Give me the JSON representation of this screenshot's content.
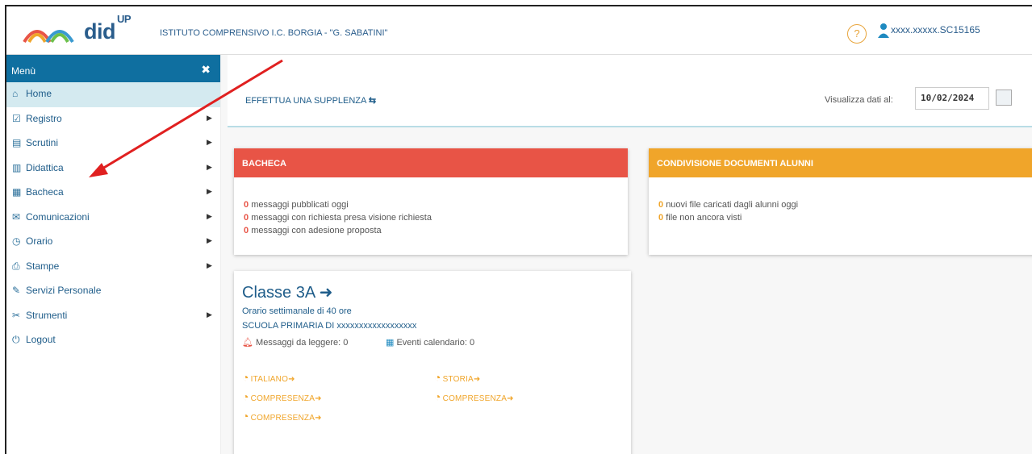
{
  "header": {
    "logo_text": "did",
    "logo_sup": "UP",
    "school": "ISTITUTO COMPRENSIVO I.C. BORGIA - \"G. SABATINI\"",
    "help_symbol": "?",
    "user": "xxxx.xxxxx.SC15165"
  },
  "sidebar": {
    "title": "Menù",
    "close_symbol": "✖",
    "items": [
      {
        "label": "Home",
        "icon": "home-icon",
        "glyph": "⌂",
        "arrow": false,
        "active": true
      },
      {
        "label": "Registro",
        "icon": "register-icon",
        "glyph": "☑",
        "arrow": true
      },
      {
        "label": "Scrutini",
        "icon": "document-icon",
        "glyph": "▤",
        "arrow": true
      },
      {
        "label": "Didattica",
        "icon": "book-icon",
        "glyph": "▥",
        "arrow": true
      },
      {
        "label": "Bacheca",
        "icon": "board-icon",
        "glyph": "▦",
        "arrow": true
      },
      {
        "label": "Comunicazioni",
        "icon": "megaphone-icon",
        "glyph": "✉",
        "arrow": true
      },
      {
        "label": "Orario",
        "icon": "clock-icon",
        "glyph": "◷",
        "arrow": true
      },
      {
        "label": "Stampe",
        "icon": "print-icon",
        "glyph": "⎙",
        "arrow": true
      },
      {
        "label": "Servizi Personale",
        "icon": "services-icon",
        "glyph": "✎",
        "arrow": false
      },
      {
        "label": "Strumenti",
        "icon": "tools-icon",
        "glyph": "✂",
        "arrow": true
      },
      {
        "label": "Logout",
        "icon": "logout-icon",
        "glyph": "⏻",
        "arrow": false
      }
    ],
    "arrow_symbol": "▶"
  },
  "toolbar": {
    "supplenza_label": "EFFETTUA UNA SUPPLENZA",
    "supplenza_symbol": "⇆",
    "date_label": "Visualizza dati al:",
    "date_value": "10/02/2024"
  },
  "bacheca": {
    "title": "BACHECA",
    "lines": [
      {
        "count": "0",
        "text": "messaggi pubblicati oggi"
      },
      {
        "count": "0",
        "text": "messaggi con richiesta presa visione richiesta"
      },
      {
        "count": "0",
        "text": "messaggi con adesione proposta"
      }
    ]
  },
  "condivisione": {
    "title": "CONDIVISIONE DOCUMENTI ALUNNI",
    "lines": [
      {
        "count": "0",
        "text": "nuovi file caricati dagli alunni oggi"
      },
      {
        "count": "0",
        "text": "file non ancora visti"
      }
    ]
  },
  "classe": {
    "title": "Classe 3A",
    "title_symbol": "➜",
    "orario": "Orario settimanale di 40 ore",
    "scuola": "SCUOLA PRIMARIA DI    xxxxxxxxxxxxxxxxxx",
    "messaggi": "Messaggi da leggere: 0",
    "eventi": "Eventi calendario: 0",
    "subjects": [
      "ITALIANO",
      "STORIA",
      "COMPRESENZA",
      "COMPRESENZA",
      "COMPRESENZA"
    ],
    "subject_symbol": "➜"
  },
  "colors": {
    "primary": "#0f6fa0",
    "bacheca": "#e85446",
    "condivisione": "#f0a52a",
    "annotation_arrow": "#e02020"
  }
}
